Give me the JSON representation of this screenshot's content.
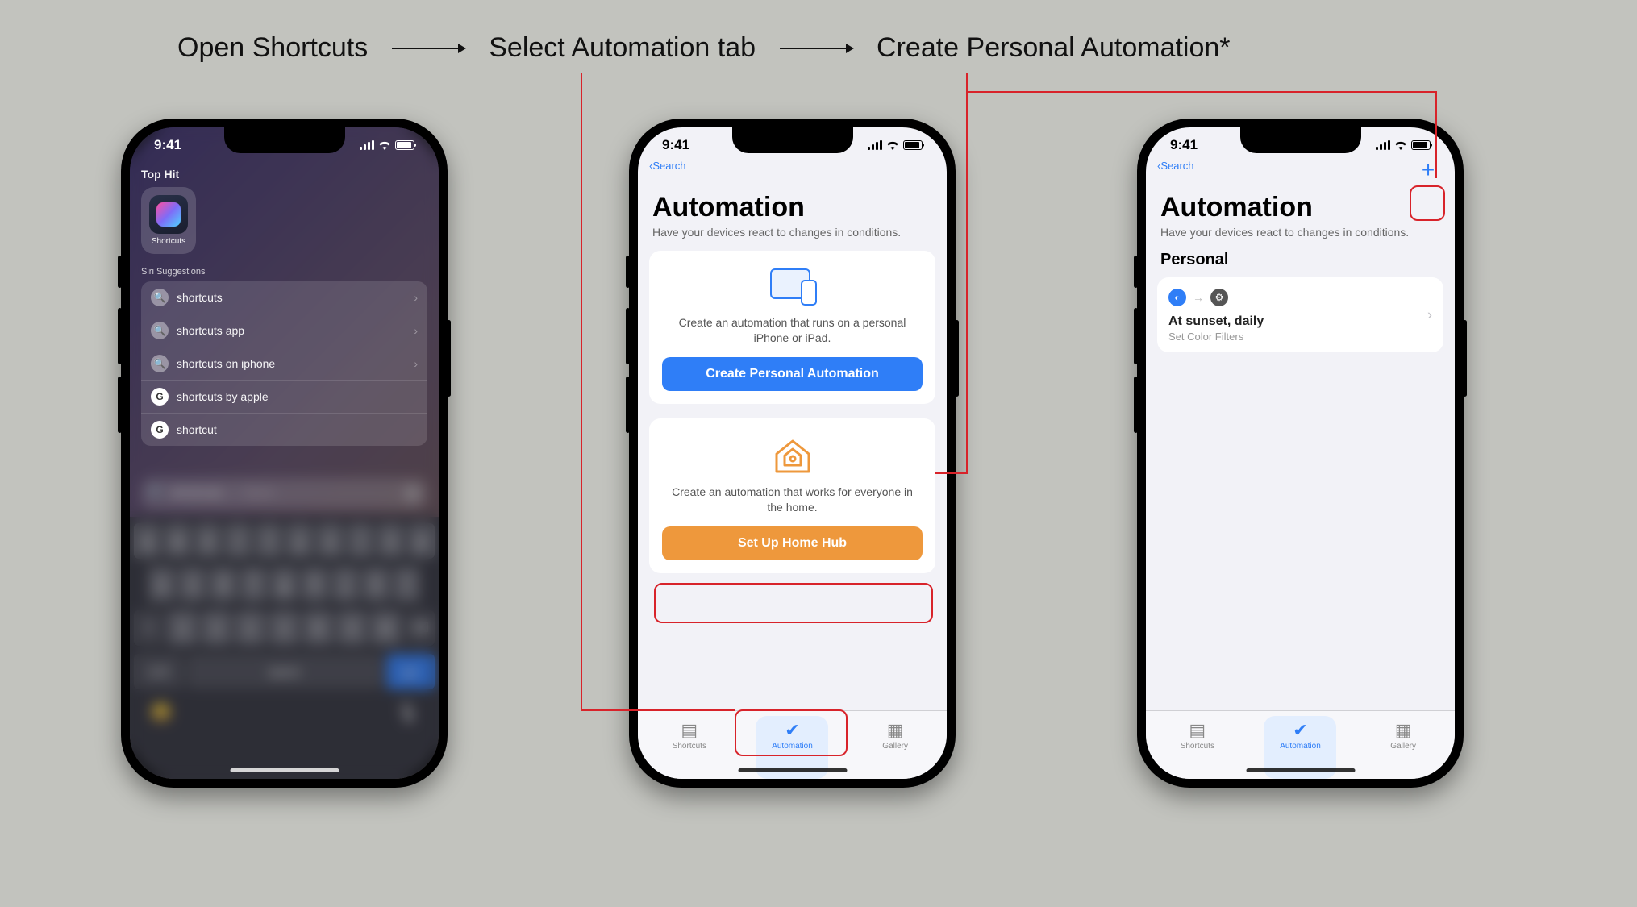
{
  "steps": [
    "Open Shortcuts",
    "Select Automation tab",
    "Create Personal Automation*"
  ],
  "status": {
    "time": "9:41"
  },
  "phone1": {
    "topHit": "Top Hit",
    "topHitLabel": "Shortcuts",
    "siri": "Siri Suggestions",
    "suggestions": [
      "shortcuts",
      "shortcuts app",
      "shortcuts on iphone",
      "shortcuts by apple",
      "shortcut"
    ],
    "searchValue": "shortcuts",
    "searchHint": " — Open",
    "keyboard": {
      "row1": [
        "q",
        "w",
        "e",
        "r",
        "t",
        "y",
        "u",
        "i",
        "o",
        "p"
      ],
      "row2": [
        "a",
        "s",
        "d",
        "f",
        "g",
        "h",
        "j",
        "k",
        "l"
      ],
      "row3": [
        "⇧",
        "z",
        "x",
        "c",
        "v",
        "b",
        "n",
        "m",
        "⌫"
      ],
      "num": "123",
      "space": "space",
      "go": "go"
    }
  },
  "phone2": {
    "backSearch": "Search",
    "title": "Automation",
    "subtitle": "Have your devices react to changes in conditions.",
    "personalDesc": "Create an automation that runs on a personal iPhone or iPad.",
    "personalCta": "Create Personal Automation",
    "homeDesc": "Create an automation that works for everyone in the home.",
    "homeCta": "Set Up Home Hub",
    "tabs": {
      "shortcuts": "Shortcuts",
      "automation": "Automation",
      "gallery": "Gallery"
    }
  },
  "phone3": {
    "backSearch": "Search",
    "title": "Automation",
    "subtitle": "Have your devices react to changes in conditions.",
    "section": "Personal",
    "item": {
      "title": "At sunset, daily",
      "subtitle": "Set Color Filters"
    },
    "tabs": {
      "shortcuts": "Shortcuts",
      "automation": "Automation",
      "gallery": "Gallery"
    }
  }
}
